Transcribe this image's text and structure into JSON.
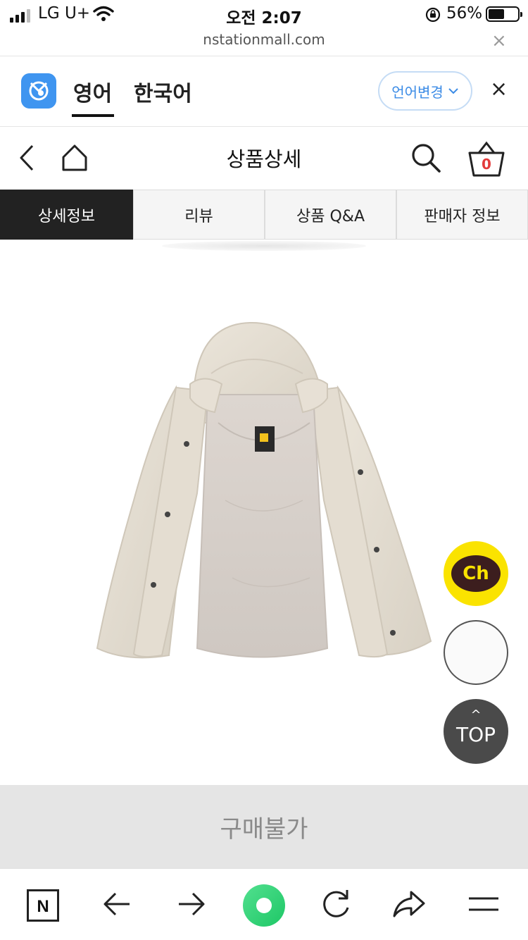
{
  "status_bar": {
    "carrier": "LG U+",
    "time": "오전 2:07",
    "battery_percent": "56%",
    "battery_level": 0.56
  },
  "browser": {
    "url": "nstationmall.com",
    "close_glyph": "×"
  },
  "translate_bar": {
    "logo_icon": "papago-logo",
    "source_lang": "영어",
    "target_lang": "한국어",
    "change_button": "언어변경",
    "close_glyph": "×",
    "accent_color": "#3b8be6"
  },
  "header": {
    "title": "상품상세",
    "cart_count": "0",
    "icons": [
      "back-arrow-icon",
      "home-icon",
      "search-icon",
      "cart-icon"
    ]
  },
  "tabs": [
    {
      "label": "상세정보",
      "active": true
    },
    {
      "label": "리뷰",
      "active": false
    },
    {
      "label": "상품 Q&A",
      "active": false
    },
    {
      "label": "판매자 정보",
      "active": false
    }
  ],
  "product": {
    "image_description_icon": "puffer-jacket-image",
    "color": "#e6e0d4"
  },
  "floating": {
    "kakao_label": "Ch",
    "top_label": "TOP",
    "top_arrow": "^"
  },
  "purchase": {
    "label": "구매불가"
  },
  "toolbar": {
    "n_label": "N",
    "icons": [
      "naver-n-icon",
      "back-icon",
      "forward-icon",
      "green-home-icon",
      "refresh-icon",
      "share-icon",
      "menu-icon"
    ]
  }
}
